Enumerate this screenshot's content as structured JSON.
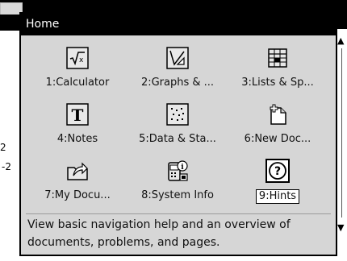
{
  "popup": {
    "title": "Home",
    "items": [
      {
        "label": "1:Calculator",
        "icon": "calculator-icon"
      },
      {
        "label": "2:Graphs & ...",
        "icon": "graphs-icon"
      },
      {
        "label": "3:Lists & Sp...",
        "icon": "spreadsheet-icon"
      },
      {
        "label": "4:Notes",
        "icon": "notes-icon"
      },
      {
        "label": "5:Data & Sta...",
        "icon": "data-statistics-icon"
      },
      {
        "label": "6:New Doc...",
        "icon": "new-document-icon"
      },
      {
        "label": "7:My Docu...",
        "icon": "my-documents-icon"
      },
      {
        "label": "8:System Info",
        "icon": "system-info-icon"
      },
      {
        "label": "9:Hints",
        "icon": "hints-icon",
        "selected": true
      }
    ],
    "description": "View basic navigation help and an overview of documents, problems, and pages."
  },
  "background": {
    "fragment_a": "2",
    "fragment_b": "-2"
  }
}
